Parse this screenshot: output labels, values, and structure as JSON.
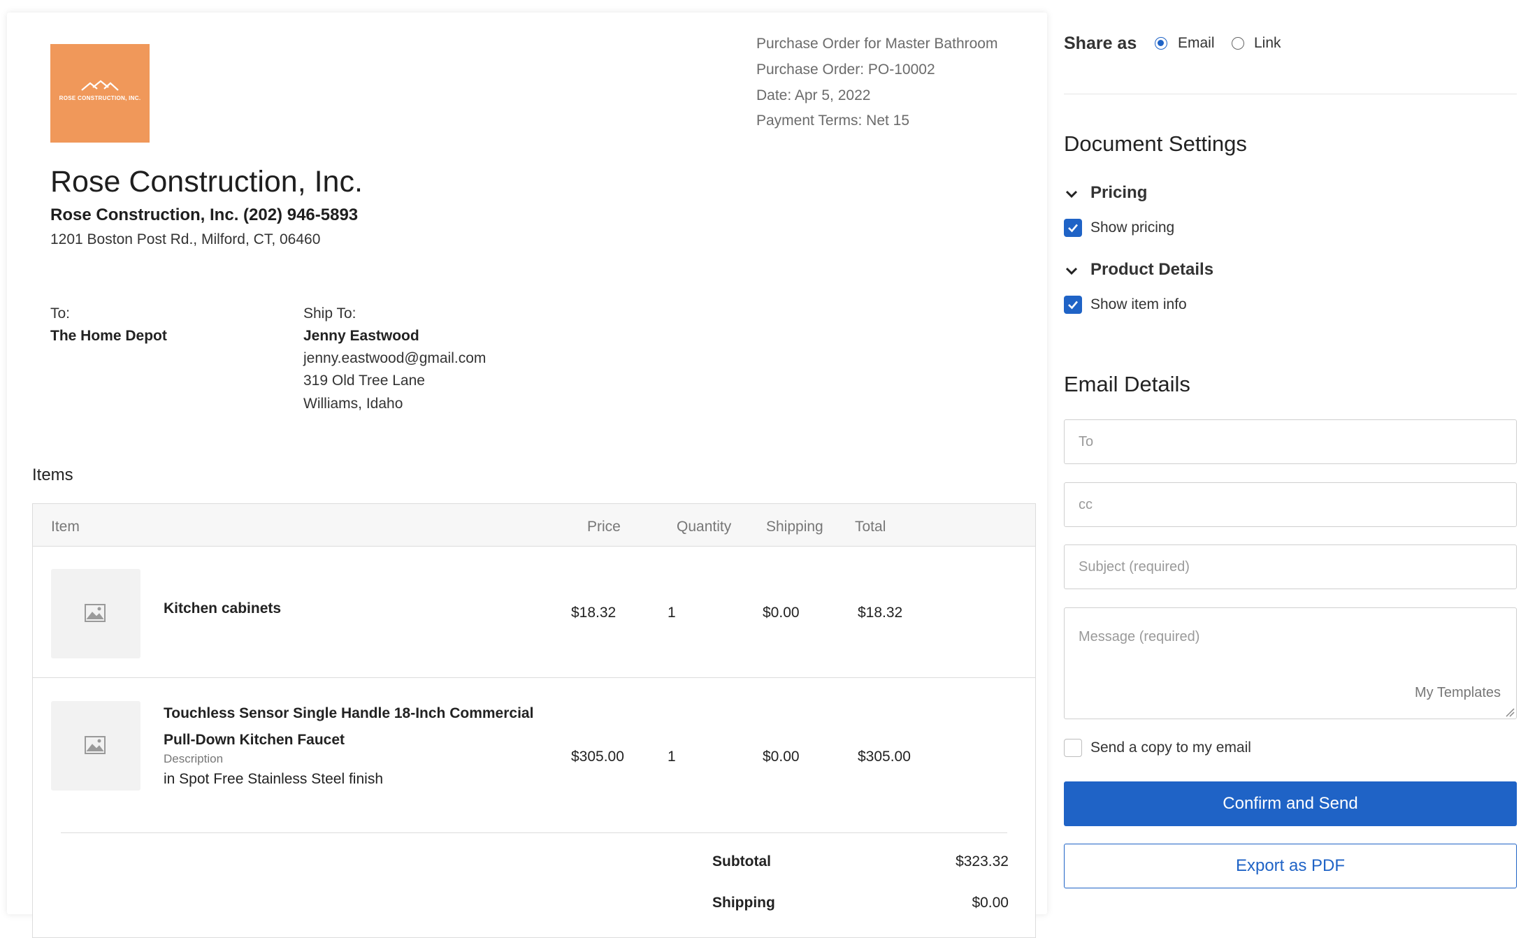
{
  "document": {
    "logo_text": "ROSE CONSTRUCTION, INC.",
    "meta": {
      "title": "Purchase Order for Master Bathroom",
      "po": "Purchase Order: PO-10002",
      "date": "Date: Apr 5, 2022",
      "terms": "Payment Terms: Net 15"
    },
    "company": {
      "name": "Rose Construction, Inc.",
      "contact": "Rose Construction, Inc. (202) 946-5893",
      "address": "1201 Boston Post Rd., Milford, CT, 06460"
    },
    "to": {
      "label": "To:",
      "name": "The Home Depot"
    },
    "ship_to": {
      "label": "Ship To:",
      "name": "Jenny Eastwood",
      "email": "jenny.eastwood@gmail.com",
      "street": "319 Old Tree Lane",
      "city": "Williams, Idaho"
    },
    "items_title": "Items",
    "columns": {
      "item": "Item",
      "price": "Price",
      "quantity": "Quantity",
      "shipping": "Shipping",
      "total": "Total"
    },
    "items": [
      {
        "name": "Kitchen cabinets",
        "price": "$18.32",
        "quantity": "1",
        "shipping": "$0.00",
        "total": "$18.32"
      },
      {
        "name_line1": "Touchless Sensor Single Handle 18-Inch Commercial",
        "name_line2": "Pull-Down Kitchen Faucet",
        "description_label": "Description",
        "description": "in Spot Free Stainless Steel finish",
        "price": "$305.00",
        "quantity": "1",
        "shipping": "$0.00",
        "total": "$305.00"
      }
    ],
    "totals": {
      "subtotal_label": "Subtotal",
      "subtotal": "$323.32",
      "shipping_label": "Shipping",
      "shipping": "$0.00"
    }
  },
  "panel": {
    "share_as_label": "Share as",
    "share_options": [
      "Email",
      "Link"
    ],
    "share_selected": "Email",
    "document_settings_title": "Document Settings",
    "pricing_title": "Pricing",
    "show_pricing_label": "Show pricing",
    "show_pricing_checked": true,
    "product_details_title": "Product Details",
    "show_item_info_label": "Show item info",
    "show_item_info_checked": true,
    "email_details_title": "Email Details",
    "to_placeholder": "To",
    "cc_placeholder": "cc",
    "subject_placeholder": "Subject (required)",
    "message_placeholder": "Message (required)",
    "templates_label": "My Templates",
    "copy_label": "Send a copy to my email",
    "copy_checked": false,
    "confirm_button": "Confirm and Send",
    "export_button": "Export as PDF",
    "accent_color": "#1f63c6",
    "logo_color": "#f0985a"
  }
}
